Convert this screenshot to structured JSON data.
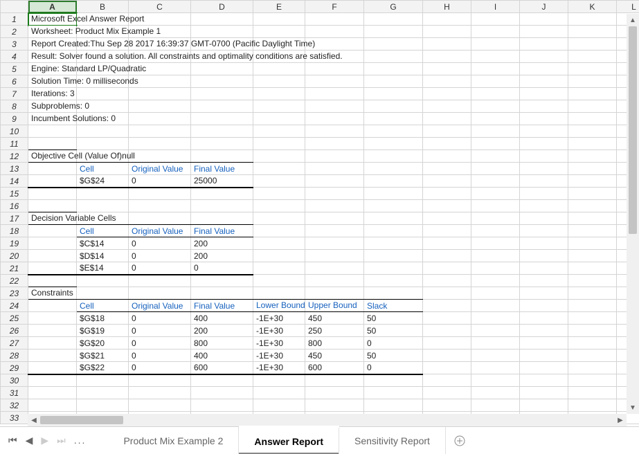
{
  "columns": [
    "A",
    "B",
    "C",
    "D",
    "E",
    "F",
    "G",
    "H",
    "I",
    "J",
    "K",
    "L"
  ],
  "report": {
    "title": "Microsoft Excel Answer Report",
    "worksheet": "Worksheet: Product Mix Example 1",
    "created": "Report Created:Thu Sep 28 2017 16:39:37 GMT-0700 (Pacific Daylight Time)",
    "result": "Result: Solver found a solution.  All constraints and optimality conditions are satisfied.",
    "engine": "Engine: Standard LP/Quadratic",
    "soltime": "Solution Time: 0 milliseconds",
    "iterations": "Iterations: 3",
    "subproblems": "Subproblems: 0",
    "incumbent": "Incumbent Solutions: 0"
  },
  "objective": {
    "heading": "Objective Cell (Value Of)null",
    "headers": {
      "cell": "Cell",
      "orig": "Original Value",
      "final": "Final Value"
    },
    "rows": [
      {
        "cell": "$G$24",
        "orig": "0",
        "final": "25000"
      }
    ]
  },
  "decision": {
    "heading": "Decision Variable Cells",
    "headers": {
      "cell": "Cell",
      "orig": "Original Value",
      "final": "Final Value"
    },
    "rows": [
      {
        "cell": "$C$14",
        "orig": "0",
        "final": "200"
      },
      {
        "cell": "$D$14",
        "orig": "0",
        "final": "200"
      },
      {
        "cell": "$E$14",
        "orig": "0",
        "final": "0"
      }
    ]
  },
  "constraints": {
    "heading": "Constraints",
    "headers": {
      "cell": "Cell",
      "orig": "Original Value",
      "final": "Final Value",
      "lower": "Lower Bound",
      "upper": "Upper Bound",
      "slack": "Slack"
    },
    "rows": [
      {
        "cell": "$G$18",
        "orig": "0",
        "final": "400",
        "lower": "-1E+30",
        "upper": "450",
        "slack": "50"
      },
      {
        "cell": "$G$19",
        "orig": "0",
        "final": "200",
        "lower": "-1E+30",
        "upper": "250",
        "slack": "50"
      },
      {
        "cell": "$G$20",
        "orig": "0",
        "final": "800",
        "lower": "-1E+30",
        "upper": "800",
        "slack": "0"
      },
      {
        "cell": "$G$21",
        "orig": "0",
        "final": "400",
        "lower": "-1E+30",
        "upper": "450",
        "slack": "50"
      },
      {
        "cell": "$G$22",
        "orig": "0",
        "final": "600",
        "lower": "-1E+30",
        "upper": "600",
        "slack": "0"
      }
    ]
  },
  "tabs": {
    "prev": "Product Mix Example 2",
    "active": "Answer Report",
    "next": "Sensitivity Report"
  }
}
